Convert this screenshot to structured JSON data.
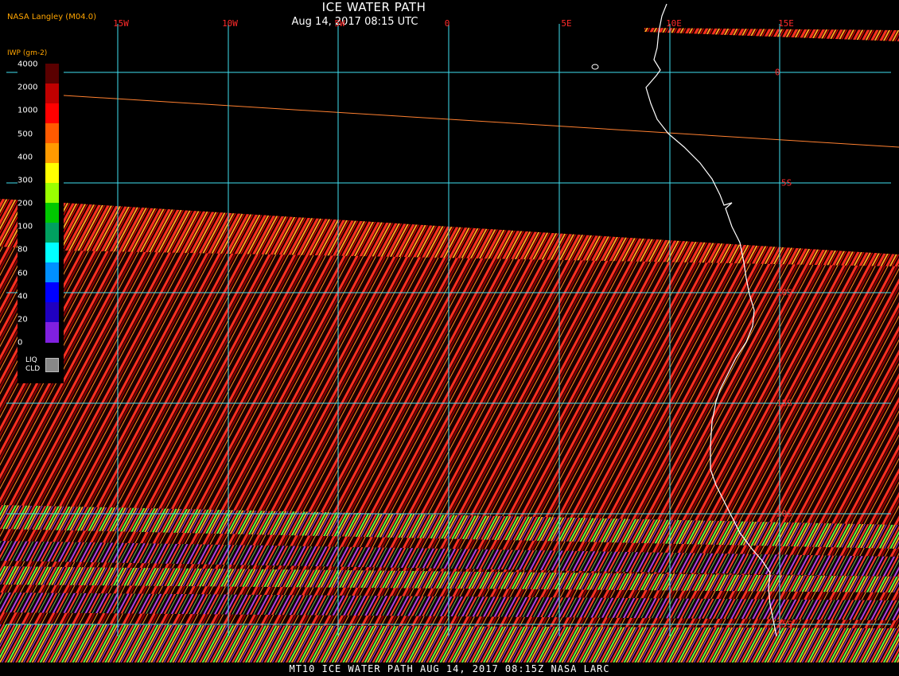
{
  "title": "ICE WATER PATH",
  "subtitle": "Aug 14, 2017 08:15 UTC",
  "provider": "NASA Langley (M04.0)",
  "footer": "MT10  ICE WATER PATH   AUG 14, 2017 08:15Z   NASA LARC",
  "legend": {
    "unit_label": "IWP (gm-2)",
    "ticks": [
      "4000",
      "2000",
      "1000",
      "500",
      "400",
      "300",
      "200",
      "100",
      "80",
      "60",
      "40",
      "20",
      "0"
    ],
    "colors": [
      "#5a0000",
      "#c00000",
      "#ff0000",
      "#ff5a00",
      "#ff9a00",
      "#ffff00",
      "#9aff00",
      "#00c800",
      "#00a060",
      "#00ffff",
      "#0090ff",
      "#0000ff",
      "#2000c0",
      "#8020e0"
    ],
    "liq_label_1": "LIQ",
    "liq_label_2": "CLD",
    "liq_color": "#888888"
  },
  "longitude_labels": [
    "15W",
    "10W",
    "5W",
    "0",
    "5E",
    "10E",
    "15E"
  ],
  "latitude_labels": [
    "0",
    "5S",
    "10S",
    "15S",
    "20S",
    "25S"
  ],
  "colors": {
    "grid": "#40e0f0",
    "coast": "#ffffff",
    "label": "#ff2a2a",
    "stripe_a": "#ff3020",
    "stripe_b": "#8a0000",
    "stripe_light_a": "#ffa020",
    "stripe_light_b": "#60ff40",
    "stripe_low": "#b040e0"
  },
  "icons": {
    "colorbar": "colorbar-legend-icon"
  }
}
